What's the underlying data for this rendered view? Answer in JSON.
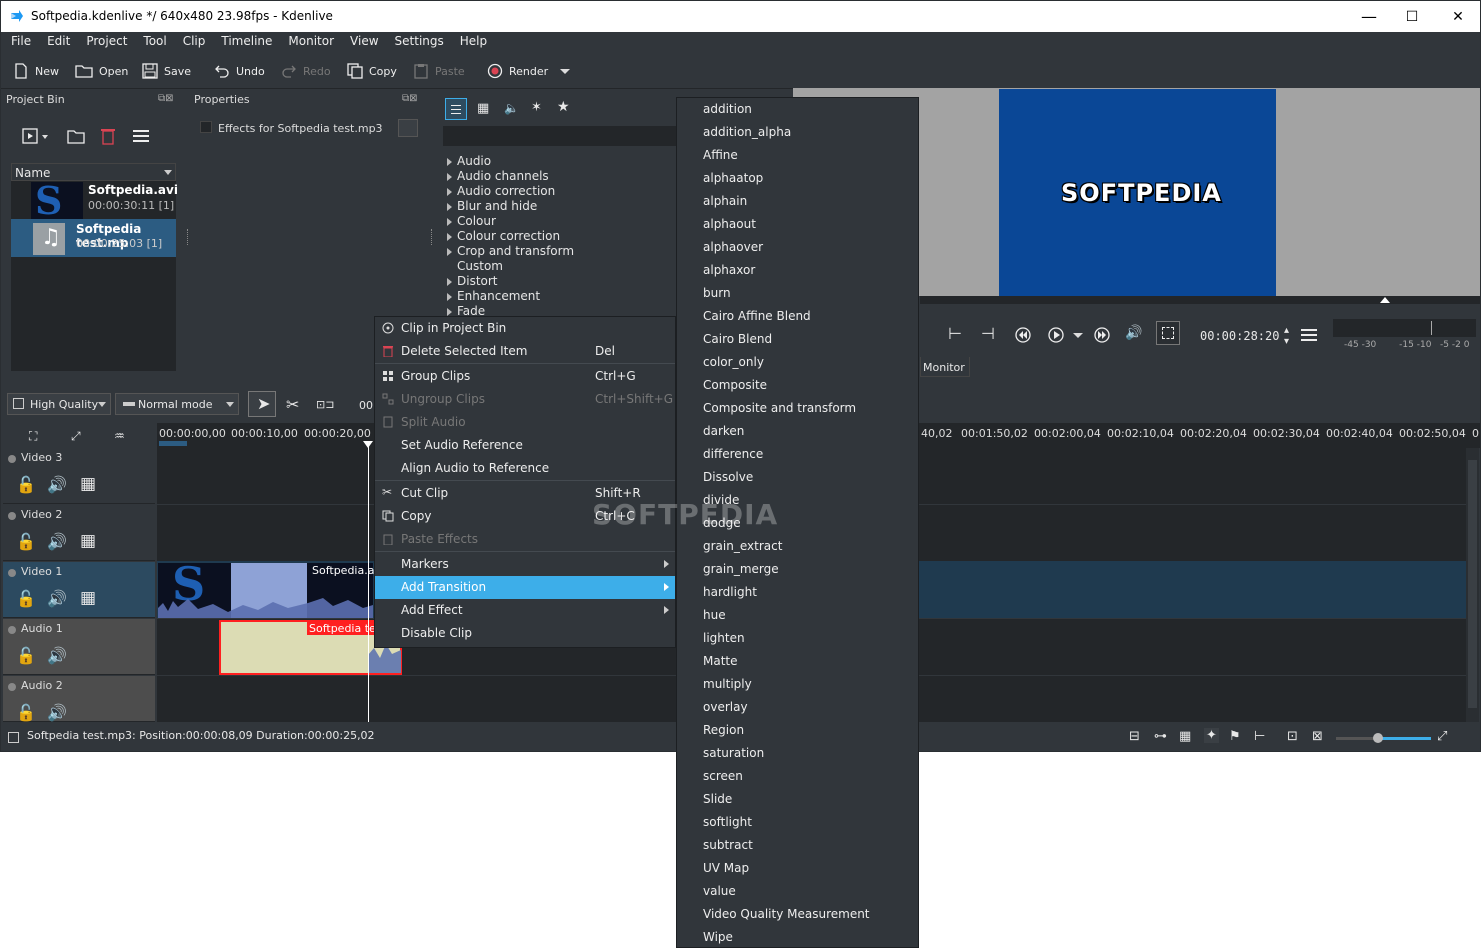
{
  "window": {
    "title": "Softpedia.kdenlive */ 640x480 23.98fps - Kdenlive",
    "minimize": "—",
    "maximize": "☐",
    "close": "✕"
  },
  "menu": [
    "File",
    "Edit",
    "Project",
    "Tool",
    "Clip",
    "Timeline",
    "Monitor",
    "View",
    "Settings",
    "Help"
  ],
  "toolbar": {
    "new": "New",
    "open": "Open",
    "save": "Save",
    "undo": "Undo",
    "redo": "Redo",
    "copy": "Copy",
    "paste": "Paste",
    "render": "Render"
  },
  "project_bin": {
    "title": "Project Bin",
    "name_header": "Name",
    "clips": [
      {
        "name": "Softpedia.avi",
        "meta": "00:00:30:11  [1]"
      },
      {
        "name": "Softpedia test.mp",
        "meta": "00:00:25:03  [1]"
      }
    ]
  },
  "properties": {
    "title": "Properties",
    "effects_for": "Effects for Softpedia test.mp3"
  },
  "effects_tree": [
    "Audio",
    "Audio channels",
    "Audio correction",
    "Blur and hide",
    "Colour",
    "Colour correction",
    "Crop and transform",
    "Custom",
    "Distort",
    "Enhancement",
    "Fade"
  ],
  "context_menu": [
    {
      "label": "Clip in Project Bin",
      "shortcut": ""
    },
    {
      "label": "Delete Selected Item",
      "shortcut": "Del"
    },
    {
      "label": "Group Clips",
      "shortcut": "Ctrl+G"
    },
    {
      "label": "Ungroup Clips",
      "shortcut": "Ctrl+Shift+G"
    },
    {
      "label": "Split Audio",
      "shortcut": ""
    },
    {
      "label": "Set Audio Reference",
      "shortcut": ""
    },
    {
      "label": "Align Audio to Reference",
      "shortcut": ""
    },
    {
      "label": "Cut Clip",
      "shortcut": "Shift+R"
    },
    {
      "label": "Copy",
      "shortcut": "Ctrl+C"
    },
    {
      "label": "Paste Effects",
      "shortcut": ""
    },
    {
      "label": "Markers",
      "shortcut": ""
    },
    {
      "label": "Add Transition",
      "shortcut": ""
    },
    {
      "label": "Add Effect",
      "shortcut": ""
    },
    {
      "label": "Disable Clip",
      "shortcut": ""
    }
  ],
  "transitions": [
    "addition",
    "addition_alpha",
    "Affine",
    "alphaatop",
    "alphain",
    "alphaout",
    "alphaover",
    "alphaxor",
    "burn",
    "Cairo Affine Blend",
    "Cairo Blend",
    "color_only",
    "Composite",
    "Composite and transform",
    "darken",
    "difference",
    "Dissolve",
    "divide",
    "dodge",
    "grain_extract",
    "grain_merge",
    "hardlight",
    "hue",
    "lighten",
    "Matte",
    "multiply",
    "overlay",
    "Region",
    "saturation",
    "screen",
    "Slide",
    "softlight",
    "subtract",
    "UV Map",
    "value",
    "Video Quality Measurement",
    "Wipe"
  ],
  "monitor": {
    "logo_text": "SOFTPEDIA",
    "timecode": "00:00:28:20",
    "tab": "Monitor",
    "meter_labels": [
      "-45",
      "-30",
      "-15",
      "-10",
      "-5",
      "-2",
      "0"
    ]
  },
  "timeline": {
    "quality": "High Quality",
    "mode": "Normal mode",
    "timecode_prefix": "00",
    "ruler_left": [
      "00:00:00,00",
      "00:00:10,00",
      "00:00:20,00"
    ],
    "ruler_right": [
      "40,02",
      "00:01:50,02",
      "00:02:00,04",
      "00:02:10,04",
      "00:02:20,04",
      "00:02:30,04",
      "00:02:40,04",
      "00:02:50,04",
      "0"
    ],
    "tracks": [
      "Video 3",
      "Video 2",
      "Video 1",
      "Audio 1",
      "Audio 2"
    ],
    "clip_video": "Softpedia.av",
    "clip_audio": "Softpedia test"
  },
  "status": {
    "text": "Softpedia test.mp3: Position:00:00:08,09 Duration:00:00:25,02"
  },
  "watermark": "SOFTPEDIA"
}
